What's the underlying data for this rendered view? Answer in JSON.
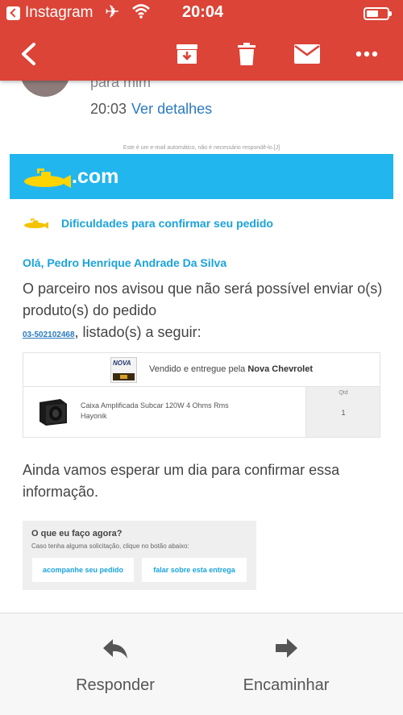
{
  "status_bar": {
    "app_name": "Instagram",
    "time": "20:04"
  },
  "toolbar": {
    "icons": [
      "back-arrow-icon",
      "archive-icon",
      "trash-icon",
      "mail-icon",
      "more-icon"
    ]
  },
  "email": {
    "to_line": "para mim",
    "time": "20:03",
    "details_link": "Ver detalhes",
    "notice": "Este é um e-mail automático, não é necessário respondê-lo.[J]",
    "logo_text": ".com",
    "difficulty_title": "Dificuldades para confirmar seu pedido",
    "greeting": "Olá, Pedro Henrique Andrade Da Silva",
    "message_part1": "O parceiro nos avisou que não será possível enviar o(s) produto(s) do pedido",
    "order_number": "03-502102468",
    "message_part2": ", listado(s) a seguir:",
    "seller_prefix": "Vendido e entregue pela ",
    "seller_name": "Nova Chevrolet",
    "seller_logo_text": "NOVA",
    "product_name": "Caixa Amplificada Subcar 120W 4 Ohms Rms Hayonik",
    "qty_label": "Qtd",
    "qty_value": "1",
    "wait_text": "Ainda vamos esperar um dia para confirmar essa informação.",
    "help_title": "O que eu faço agora?",
    "help_sub": "Caso tenha alguma solicitação, clique no botão abaixo:",
    "button_track": "acompanhe seu pedido",
    "button_talk": "falar sobre esta entrega"
  },
  "actions": {
    "reply": "Responder",
    "forward": "Encaminhar"
  },
  "colors": {
    "header_red": "#db4437",
    "brand_blue": "#22b6ee",
    "link_blue": "#2a7ac0",
    "brand_yellow": "#ffd400"
  }
}
